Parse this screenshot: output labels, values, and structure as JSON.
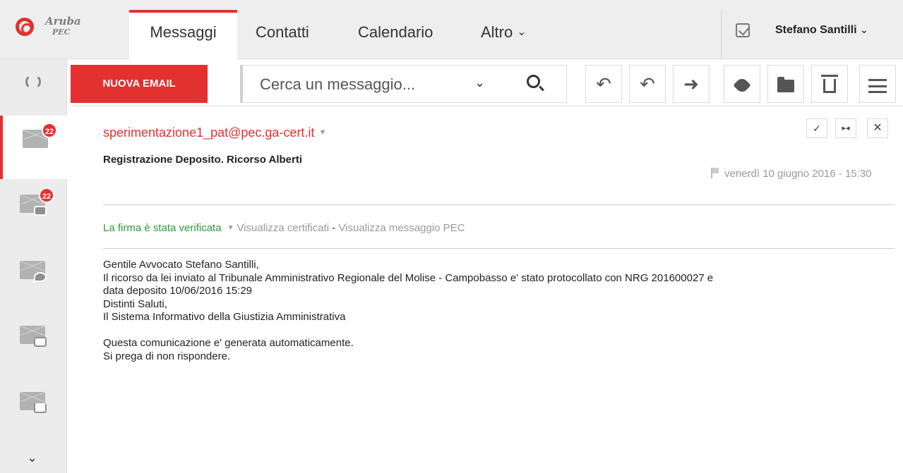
{
  "logo": {
    "line1": "Aruba",
    "line2": "PEC"
  },
  "tabs": {
    "messaggi": "Messaggi",
    "contatti": "Contatti",
    "calendario": "Calendario",
    "altro": "Altro"
  },
  "user": {
    "name": "Stefano Santilli"
  },
  "sidebar": {
    "badge_inbox": "22",
    "badge_pec": "22"
  },
  "toolbar": {
    "new_email_label": "NUOVA EMAIL",
    "search_placeholder": "Cerca un messaggio..."
  },
  "message": {
    "sender": "sperimentazione1_pat@pec.ga-cert.it",
    "subject": "Registrazione Deposito.  Ricorso Alberti",
    "date": "venerdì 10 giugno 2016 - 15:30",
    "signature_status": "La firma è stata verificata",
    "view_certificates": "Visualizza certificati",
    "separator": " - ",
    "view_pec": "Visualizza messaggio PEC",
    "body_lines": [
      "Gentile Avvocato Stefano Santilli,",
      "Il ricorso da lei inviato al Tribunale Amministrativo Regionale del Molise - Campobasso e' stato protocollato con NRG 201600027 e",
      "data deposito 10/06/2016 15:29",
      "Distinti Saluti,",
      "Il Sistema Informativo della Giustizia Amministrativa",
      "",
      "Questa comunicazione e' generata automaticamente.",
      "Si prega di non rispondere."
    ]
  },
  "colors": {
    "accent": "#e3312f",
    "verified": "#2e9a3a"
  }
}
